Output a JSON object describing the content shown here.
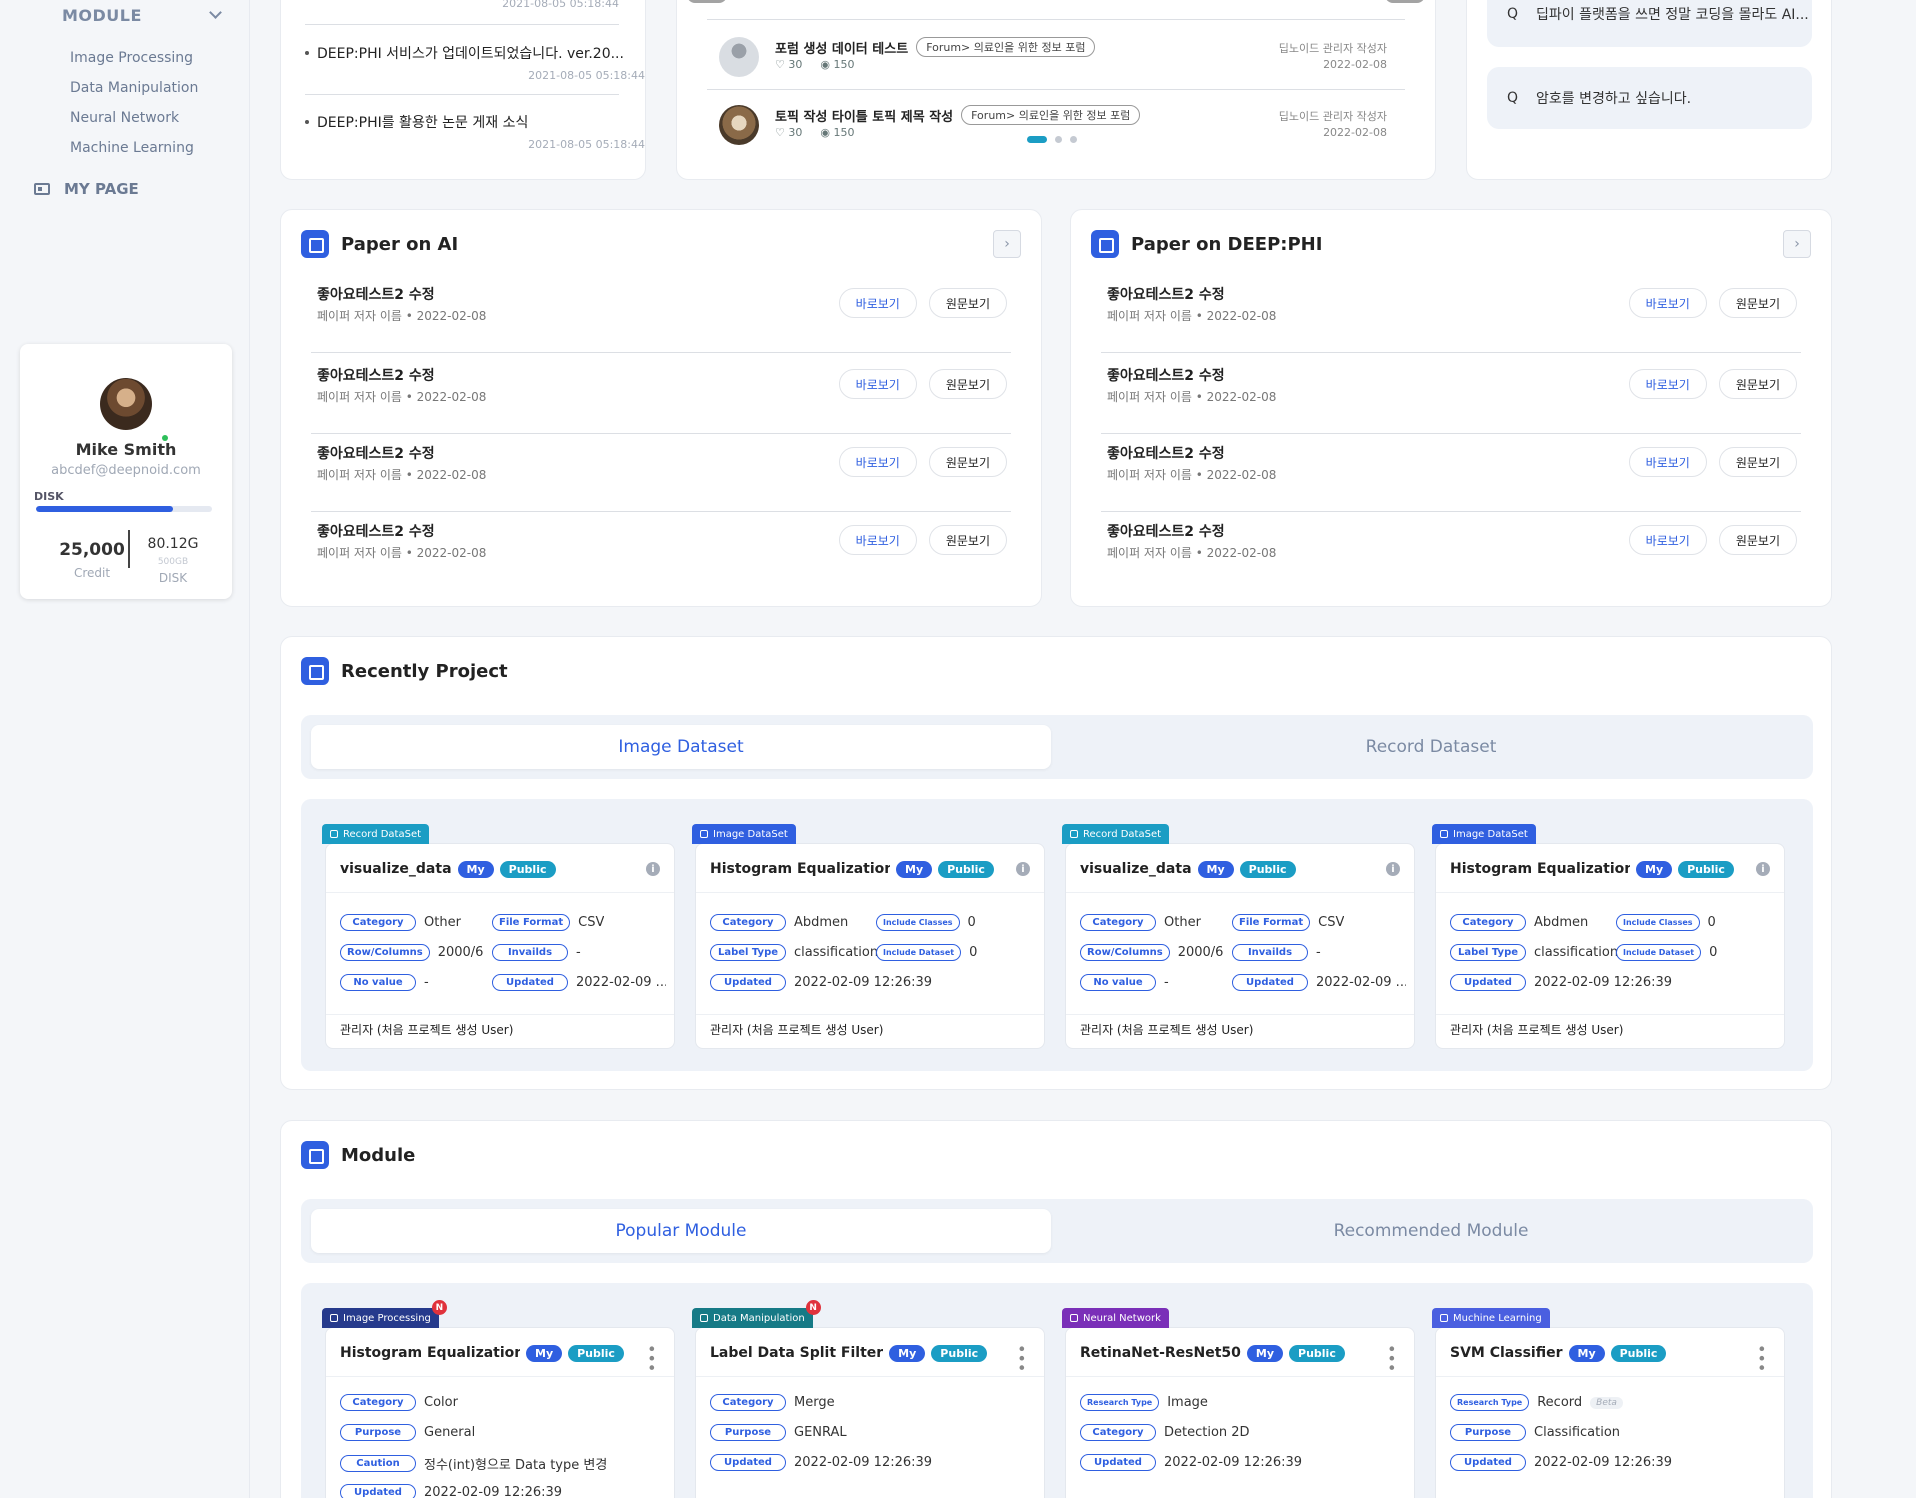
{
  "sidebar": {
    "module_label": "MODULE",
    "sub_items": [
      "Image Processing",
      "Data Manipulation",
      "Neural Network",
      "Machine Learning"
    ],
    "mypage_label": "MY PAGE"
  },
  "profile": {
    "name": "Mike Smith",
    "email": "abcdef@deepnoid.com",
    "disk_label": "DISK",
    "disk_usage_fraction": 0.78,
    "credit_value": "25,000",
    "credit_label": "Credit",
    "disk_value": "80.12G",
    "disk_capacity": "500GB",
    "disk_value_label": "DISK"
  },
  "notices": {
    "top_date": "2021-08-05 05:18:44",
    "items": [
      {
        "title": "DEEP:PHI 서비스가 업데이트되었습니다. ver.20...",
        "date": "2021-08-05 05:18:44"
      },
      {
        "title": "DEEP:PHI를 활용한 논문 게재 소식",
        "date": "2021-08-05 05:18:44"
      }
    ]
  },
  "forum": {
    "items": [
      {
        "title": "포럼 생성 데이터 테스트",
        "tag": "Forum> 의료인을 위한 정보 포럼",
        "likes": "30",
        "views": "150",
        "author": "딥노이드 관리자 작성자",
        "date": "2022-02-08"
      },
      {
        "title": "토픽 작성 타이틀 토픽 제목 작성",
        "tag": "Forum> 의료인을 위한 정보 포럼",
        "likes": "30",
        "views": "150",
        "author": "딥노이드 관리자 작성자",
        "date": "2022-02-08"
      }
    ],
    "active_page": 0,
    "page_count": 3
  },
  "faq": {
    "prefix": "Q",
    "items": [
      "딥파이 플랫폼을 쓰면 정말 코딩을 몰라도 AI...",
      "암호를 변경하고 싶습니다."
    ]
  },
  "paper_ai": {
    "title": "Paper on AI",
    "items": [
      {
        "title": "좋아요테스트2 수정",
        "meta": "페이퍼 저자 이름 • 2022-02-08"
      },
      {
        "title": "좋아요테스트2 수정",
        "meta": "페이퍼 저자 이름 • 2022-02-08"
      },
      {
        "title": "좋아요테스트2 수정",
        "meta": "페이퍼 저자 이름 • 2022-02-08"
      },
      {
        "title": "좋아요테스트2 수정",
        "meta": "페이퍼 저자 이름 • 2022-02-08"
      }
    ],
    "view_label": "바로보기",
    "original_label": "원문보기"
  },
  "paper_deepphi": {
    "title": "Paper on DEEP:PHI",
    "items": [
      {
        "title": "좋아요테스트2 수정",
        "meta": "페이퍼 저자 이름 • 2022-02-08"
      },
      {
        "title": "좋아요테스트2 수정",
        "meta": "페이퍼 저자 이름 • 2022-02-08"
      },
      {
        "title": "좋아요테스트2 수정",
        "meta": "페이퍼 저자 이름 • 2022-02-08"
      },
      {
        "title": "좋아요테스트2 수정",
        "meta": "페이퍼 저자 이름 • 2022-02-08"
      }
    ],
    "view_label": "바로보기",
    "original_label": "원문보기"
  },
  "recent_project": {
    "title": "Recently Project",
    "tabs": [
      "Image Dataset",
      "Record Dataset"
    ],
    "cards": [
      {
        "ribbon": "Record DataSet",
        "ribbon_color": "#1b9dc4",
        "title": "visualize_data",
        "my": "My",
        "public": "Public",
        "fields": [
          [
            "Category",
            "Other"
          ],
          [
            "File Format",
            "CSV"
          ],
          [
            "Row/Columns",
            "2000/6"
          ],
          [
            "Invailds",
            "-"
          ],
          [
            "No value",
            "-"
          ],
          [
            "Updated",
            "2022-02-09 ..."
          ]
        ],
        "footer": "관리자 (처음 프로젝트 생성 User)"
      },
      {
        "ribbon": "Image DataSet",
        "ribbon_color": "#2f5fe0",
        "title": "Histogram Equalization C...",
        "my": "My",
        "public": "Public",
        "fields": [
          [
            "Category",
            "Abdmen"
          ],
          [
            "Include Classes",
            "0"
          ],
          [
            "Label Type",
            "classification"
          ],
          [
            "Include Dataset",
            "0"
          ],
          [
            "Updated",
            "2022-02-09 12:26:39"
          ]
        ],
        "footer": "관리자 (처음 프로젝트 생성 User)"
      },
      {
        "ribbon": "Record DataSet",
        "ribbon_color": "#1b9dc4",
        "title": "visualize_data",
        "my": "My",
        "public": "Public",
        "fields": [
          [
            "Category",
            "Other"
          ],
          [
            "File Format",
            "CSV"
          ],
          [
            "Row/Columns",
            "2000/6"
          ],
          [
            "Invailds",
            "-"
          ],
          [
            "No value",
            "-"
          ],
          [
            "Updated",
            "2022-02-09 ..."
          ]
        ],
        "footer": "관리자 (처음 프로젝트 생성 User)"
      },
      {
        "ribbon": "Image DataSet",
        "ribbon_color": "#2f5fe0",
        "title": "Histogram Equalization C...",
        "my": "My",
        "public": "Public",
        "fields": [
          [
            "Category",
            "Abdmen"
          ],
          [
            "Include Classes",
            "0"
          ],
          [
            "Label Type",
            "classification"
          ],
          [
            "Include Dataset",
            "0"
          ],
          [
            "Updated",
            "2022-02-09 12:26:39"
          ]
        ],
        "footer": "관리자 (처음 프로젝트 생성 User)"
      }
    ]
  },
  "module": {
    "title": "Module",
    "tabs": [
      "Popular Module",
      "Recommended Module"
    ],
    "cards": [
      {
        "ribbon": "Image Processing",
        "ribbon_color": "#263a8c",
        "new": "N",
        "title": "Histogram Equalization C...",
        "my": "My",
        "public": "Public",
        "fields": [
          [
            "Category",
            "Color"
          ],
          [
            "Purpose",
            "General"
          ],
          [
            "Caution",
            "정수(int)형으로 Data type 변경"
          ],
          [
            "Updated",
            "2022-02-09 12:26:39"
          ]
        ]
      },
      {
        "ribbon": "Data Manipulation",
        "ribbon_color": "#167a86",
        "new": "N",
        "title": "Label Data Split Filter",
        "my": "My",
        "public": "Public",
        "fields": [
          [
            "Category",
            "Merge"
          ],
          [
            "Purpose",
            "GENRAL"
          ],
          [
            "Updated",
            "2022-02-09 12:26:39"
          ]
        ]
      },
      {
        "ribbon": "Neural Network",
        "ribbon_color": "#7a2fb8",
        "new": "",
        "title": "RetinaNet-ResNet50",
        "my": "My",
        "public": "Public",
        "fields": [
          [
            "Research Type",
            "Image"
          ],
          [
            "Category",
            "Detection 2D"
          ],
          [
            "Updated",
            "2022-02-09 12:26:39"
          ]
        ]
      },
      {
        "ribbon": "Muchine Learning",
        "ribbon_color": "#4a5fe0",
        "new": "",
        "title": "SVM Classifier",
        "my": "My",
        "public": "Public",
        "beta": "Beta",
        "fields": [
          [
            "Research Type",
            "Record"
          ],
          [
            "Purpose",
            "Classification"
          ],
          [
            "Updated",
            "2022-02-09 12:26:39"
          ]
        ]
      }
    ]
  }
}
